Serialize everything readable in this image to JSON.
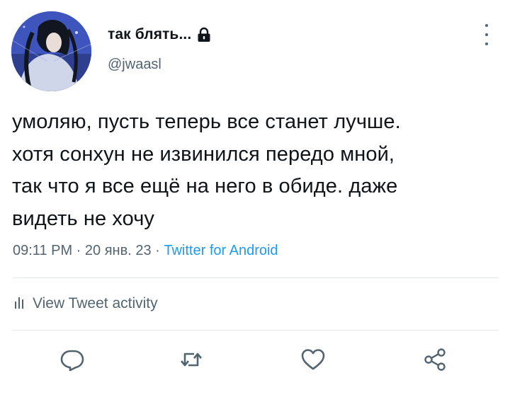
{
  "author": {
    "display_name": "так блять...",
    "handle": "@jwaasl",
    "protected": true
  },
  "tweet": {
    "text": "умоляю, пусть теперь все станет лучше.\nхотя сонхун не извинился передо мной,\nтак что я все ещё на него в обиде. даже\nвидеть не хочу"
  },
  "meta": {
    "time": "09:11 PM",
    "separator": " · ",
    "date": "20 янв. 23",
    "source": "Twitter for Android"
  },
  "activity": {
    "label": "View Tweet activity",
    "icon": "analytics-bars-icon"
  },
  "actions": {
    "icons": [
      "reply-icon",
      "retweet-icon",
      "like-icon",
      "share-icon"
    ]
  },
  "colors": {
    "text_primary": "#0f1419",
    "text_secondary": "#536471",
    "link": "#1d9bf0",
    "divider": "#e1e6ea"
  }
}
